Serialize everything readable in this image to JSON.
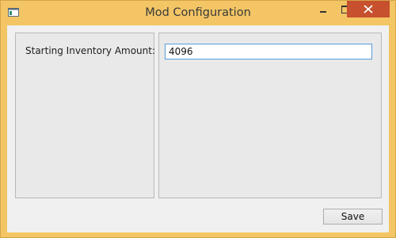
{
  "window": {
    "title": "Mod Configuration",
    "app_icon": "window-app-icon",
    "controls": {
      "minimize_icon": "minimize-icon",
      "maximize_icon": "maximize-icon",
      "close_icon": "close-icon"
    },
    "colors": {
      "frame": "#f3c565",
      "close_button": "#c7502e",
      "input_focus_border": "#5a9bd8"
    }
  },
  "form": {
    "starting_inventory_label": "Starting Inventory Amount:",
    "starting_inventory_value": "4096"
  },
  "actions": {
    "save_label": "Save"
  }
}
